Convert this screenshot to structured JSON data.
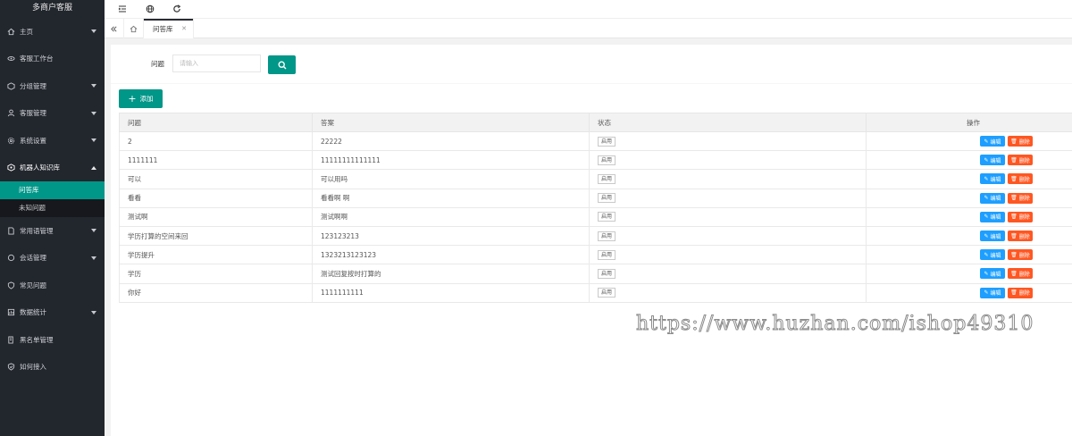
{
  "app": {
    "title": "多商户客服"
  },
  "sidebar": {
    "items": [
      {
        "label": "主页",
        "icon": "home-icon",
        "has_children": true
      },
      {
        "label": "客服工作台",
        "icon": "eye-icon",
        "has_children": false
      },
      {
        "label": "分组管理",
        "icon": "group-icon",
        "has_children": true
      },
      {
        "label": "客服管理",
        "icon": "user-icon",
        "has_children": true
      },
      {
        "label": "系统设置",
        "icon": "gear-icon",
        "has_children": true
      },
      {
        "label": "机器人知识库",
        "icon": "robot-icon",
        "has_children": true,
        "open": true,
        "children": [
          {
            "label": "问答库",
            "active": true
          },
          {
            "label": "未知问题"
          }
        ]
      },
      {
        "label": "常用语管理",
        "icon": "note-icon",
        "has_children": true
      },
      {
        "label": "会话管理",
        "icon": "chat-icon",
        "has_children": true
      },
      {
        "label": "常见问题",
        "icon": "shield-icon",
        "has_children": false
      },
      {
        "label": "数据统计",
        "icon": "chart-icon",
        "has_children": true
      },
      {
        "label": "黑名单管理",
        "icon": "blacklist-icon",
        "has_children": false
      },
      {
        "label": "如何接入",
        "icon": "link-icon",
        "has_children": false
      }
    ]
  },
  "tabs": [
    {
      "label": "问答库",
      "closable": true
    }
  ],
  "search": {
    "label": "问题",
    "placeholder": "请输入",
    "value": ""
  },
  "toolbar": {
    "add_label": "添加"
  },
  "table": {
    "columns": [
      "问题",
      "答案",
      "状态",
      "操作"
    ],
    "rows": [
      {
        "question": "2",
        "answer": "22222",
        "status": "启用"
      },
      {
        "question": "1111111",
        "answer": "11111111111111",
        "status": "启用"
      },
      {
        "question": "可以",
        "answer": "可以用吗",
        "status": "启用"
      },
      {
        "question": "看看",
        "answer": "看看啊 啊",
        "status": "启用"
      },
      {
        "question": "测试啊",
        "answer": "测试啊啊",
        "status": "启用"
      },
      {
        "question": "学历打算的空间来回",
        "answer": "123123213",
        "status": "启用"
      },
      {
        "question": "学历提升",
        "answer": "1323213123123",
        "status": "启用"
      },
      {
        "question": "学历",
        "answer": "测试回复按时打算的",
        "status": "启用"
      },
      {
        "question": "你好",
        "answer": "1111111111",
        "status": "启用"
      }
    ],
    "edit_label": "编辑",
    "delete_label": "删除"
  },
  "watermark": "https://www.huzhan.com/ishop49310",
  "colors": {
    "sidebar_bg": "#22262d",
    "accent": "#009688",
    "edit": "#1e9fff",
    "delete": "#ff5722"
  }
}
